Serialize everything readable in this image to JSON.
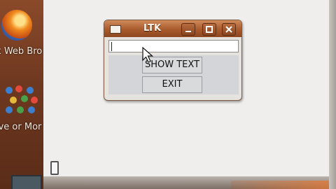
{
  "desktop": {
    "icon1_label": "x Web Bro",
    "icon2_label": "ive or Mor"
  },
  "window": {
    "title": "LTK",
    "entry_value": "",
    "buttons": {
      "show_text": "SHOW TEXT",
      "exit": "EXIT"
    }
  },
  "icons": {
    "window_menu": "window-menu-icon",
    "minimize": "minimize-icon",
    "maximize": "maximize-icon",
    "close": "close-icon",
    "pointer": "mouse-pointer-icon"
  },
  "colors": {
    "titlebar": "#a85a2c",
    "desktop": "#6b3a22",
    "window_bg": "#e6e3df"
  }
}
